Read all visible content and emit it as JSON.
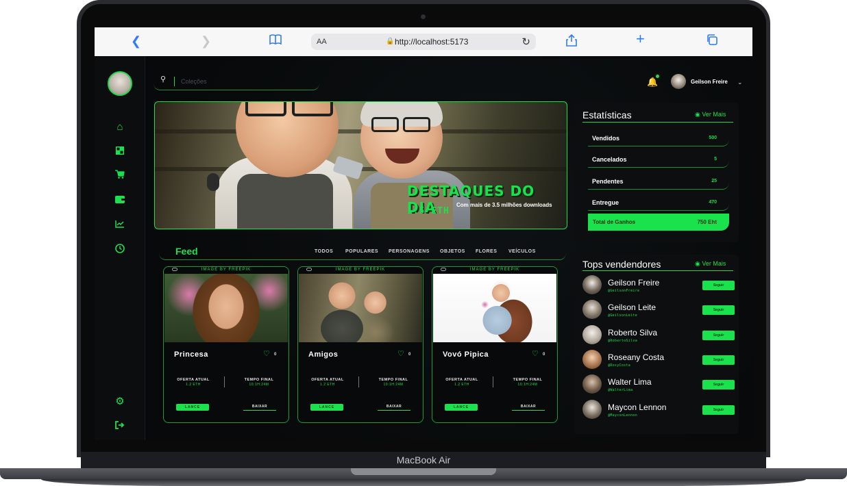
{
  "device": {
    "label": "MacBook Air"
  },
  "browser": {
    "text_size": "AA",
    "url": "http://localhost:5173",
    "icons": [
      "chevron-left-icon",
      "chevron-right-icon",
      "book-icon",
      "lock-icon",
      "reload-icon",
      "share-icon",
      "plus-icon",
      "tabs-icon"
    ]
  },
  "search": {
    "placeholder": "Coleções"
  },
  "user": {
    "name": "Geilson Freire"
  },
  "sidebar": {
    "items": [
      {
        "icon": "home-icon"
      },
      {
        "icon": "grid-icon"
      },
      {
        "icon": "cart-icon"
      },
      {
        "icon": "wallet-icon"
      },
      {
        "icon": "chart-icon"
      },
      {
        "icon": "clock-icon"
      },
      {
        "icon": "settings-icon"
      },
      {
        "icon": "logout-icon"
      }
    ]
  },
  "banner": {
    "title": "DESTAQUES DO DIA",
    "price": "1.5 ETH",
    "subtitle": "Com mais de 3.5 milhões downloads"
  },
  "feed": {
    "title": "Feed",
    "tabs": [
      "TODOS",
      "POPULARES",
      "PERSONAGENS",
      "OBJETOS",
      "FLORES",
      "VEÍCULOS"
    ],
    "cards": [
      {
        "credit": "IMAGE BY FREEPIK",
        "name": "Princesa",
        "likes": "0",
        "offer_label": "OFERTA ATUAL",
        "offer_value": "1.2 ETH",
        "time_label": "TEMPO FINAL",
        "time_value": "10:1H:24M",
        "bid_label": "LANCE",
        "download_label": "BAIXAR"
      },
      {
        "credit": "IMAGE BY FREEPIK",
        "name": "Amigos",
        "likes": "0",
        "offer_label": "OFERTA ATUAL",
        "offer_value": "1.2 ETH",
        "time_label": "TEMPO FINAL",
        "time_value": "10:1H:24M",
        "bid_label": "LANCE",
        "download_label": "BAIXAR"
      },
      {
        "credit": "IMAGE BY FREEPIK",
        "name": "Vovó Pipica",
        "likes": "0",
        "offer_label": "OFERTA ATUAL",
        "offer_value": "1.2 ETH",
        "time_label": "TEMPO FINAL",
        "time_value": "10:1H:24M",
        "bid_label": "LANCE",
        "download_label": "BAIXAR"
      }
    ]
  },
  "stats": {
    "title": "Estatísticas",
    "see_more": "Ver Mais",
    "rows": [
      {
        "label": "Vendidos",
        "value": "500"
      },
      {
        "label": "Cancelados",
        "value": "5"
      },
      {
        "label": "Pendentes",
        "value": "25"
      },
      {
        "label": "Entregue",
        "value": "470"
      }
    ],
    "total_label": "Total de Ganhos",
    "total_value": "750 Eht"
  },
  "sellers": {
    "title": "Tops vendendores",
    "see_more": "Ver Mais",
    "follow_label": "Seguir",
    "items": [
      {
        "name": "Geilson Freire",
        "handle": "@GeilsonFreire"
      },
      {
        "name": "Geilson Leite",
        "handle": "@GeilsonLeite"
      },
      {
        "name": "Roberto Silva",
        "handle": "@RobertoSilva"
      },
      {
        "name": "Roseany Costa",
        "handle": "@RosyCosta"
      },
      {
        "name": "Walter Lima",
        "handle": "@WalterLima"
      },
      {
        "name": "Maycon Lennon",
        "handle": "@MayconLennon"
      }
    ]
  },
  "colors": {
    "accent": "#19e24d",
    "background": "#07090a"
  }
}
